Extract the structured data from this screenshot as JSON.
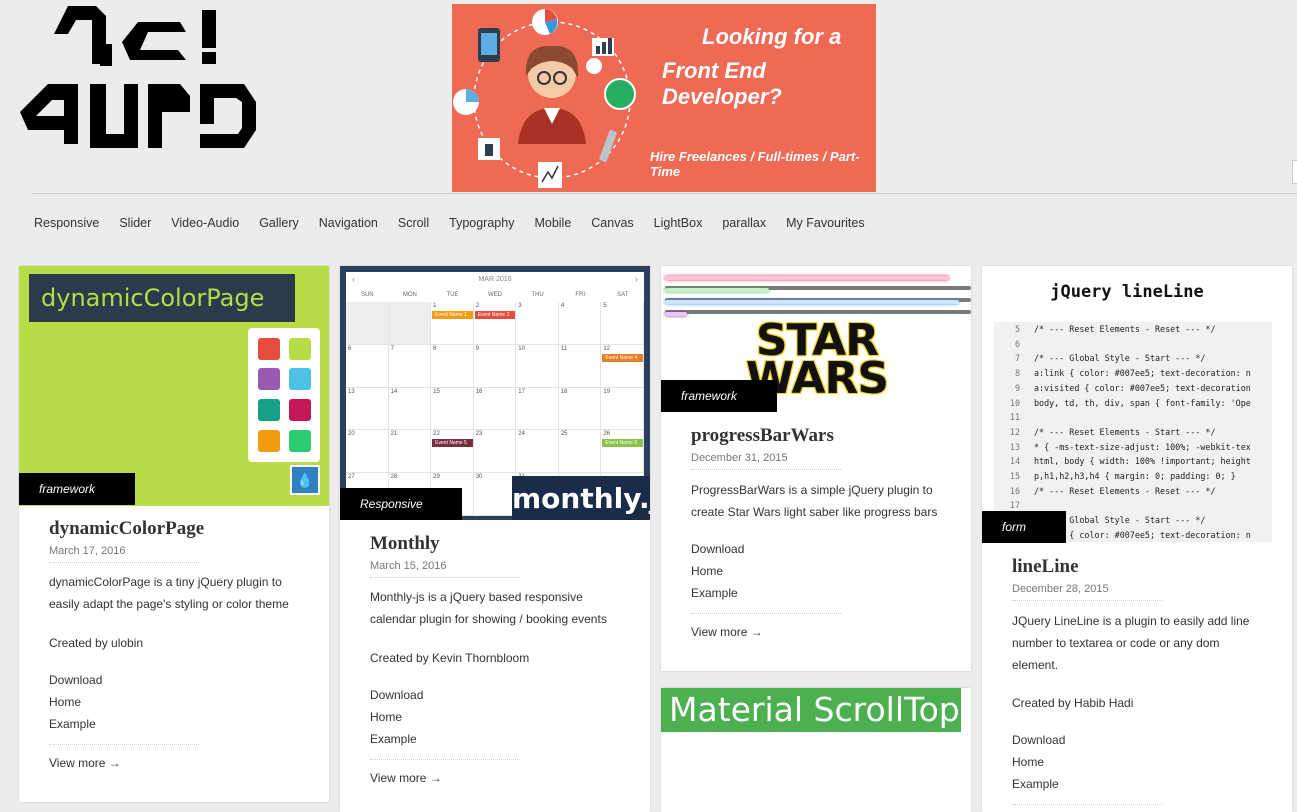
{
  "banner": {
    "line1": "Looking for a",
    "line2": "Front End Developer?",
    "line3": "Hire Freelances / Full-times / Part-Time"
  },
  "nav": [
    "Responsive",
    "Slider",
    "Video-Audio",
    "Gallery",
    "Navigation",
    "Scroll",
    "Typography",
    "Mobile",
    "Canvas",
    "LightBox",
    "parallax",
    "My Favourites"
  ],
  "cards": [
    {
      "tag": "framework",
      "thumb_title": "dynamicColorPage",
      "title": "dynamicColorPage",
      "date": "March 17, 2016",
      "desc_lines": [
        "dynamicColorPage is a tiny jQuery plugin to",
        "easily adapt the page's styling or color theme"
      ],
      "author": "Created by ulobin",
      "links": [
        "Download",
        "Home",
        "Example"
      ],
      "more": "View more →"
    },
    {
      "tag": "Responsive",
      "thumb_title": "monthly.js",
      "title": "Monthly",
      "date": "March 15, 2016",
      "desc_lines": [
        "Monthly-js is a jQuery based responsive",
        "calendar plugin for showing / booking events"
      ],
      "author": "Created by Kevin Thornbloom",
      "links": [
        "Download",
        "Home",
        "Example"
      ],
      "more": "View more →"
    },
    {
      "tag": "framework",
      "thumb_title": "STAR WARS",
      "title": "progressBarWars",
      "date": "December 31, 2015",
      "desc_lines": [
        "ProgressBarWars is a simple jQuery plugin to",
        "create Star Wars light saber like progress bars"
      ],
      "links": [
        "Download",
        "Home",
        "Example"
      ],
      "more": "View more →"
    },
    {
      "tag": "form",
      "thumb_title": "jQuery lineLine",
      "title": "lineLine",
      "date": "December 28, 2015",
      "desc_lines": [
        "JQuery LineLine is a plugin to easily add line",
        "number to textarea or code or any dom",
        "element."
      ],
      "author": "Created by Habib Hadi",
      "links": [
        "Download",
        "Home",
        "Example"
      ]
    }
  ],
  "calendar": {
    "month": "MAR 2016",
    "days": [
      "SUN",
      "MON",
      "TUE",
      "WED",
      "THU",
      "FRI",
      "SAT"
    ],
    "events": [
      "Event Name 1",
      "Event Name 2",
      "Event Name 4",
      "Event Name 5",
      "Event Name 6"
    ]
  },
  "code_lines": [
    [
      "5",
      "/* --- Reset Elements - Reset --- */"
    ],
    [
      "6",
      ""
    ],
    [
      "7",
      "/* --- Global Style - Start --- */"
    ],
    [
      "8",
      "a:link { color: #007ee5; text-decoration: n"
    ],
    [
      "9",
      "a:visited { color: #007ee5; text-decoration"
    ],
    [
      "10",
      "body, td, th, div, span { font-family: 'Ope"
    ],
    [
      "11",
      ""
    ],
    [
      "12",
      "/* --- Reset Elements - Start --- */"
    ],
    [
      "13",
      "* { -ms-text-size-adjust: 100%; -webkit-tex"
    ],
    [
      "14",
      "html, body { width: 100% !important; height"
    ],
    [
      "15",
      "p,h1,h2,h3,h4 { margin: 0; padding: 0; }"
    ],
    [
      "16",
      "/* --- Reset Elements - Reset --- */"
    ],
    [
      "17",
      ""
    ],
    [
      "18",
      "/* --- Global Style - Start --- */"
    ],
    [
      "19",
      "a:link { color: #007ee5; text-decoration: n"
    ]
  ],
  "material": "Material ScrollTop",
  "colors": {
    "banner": "#ef6a55",
    "lime": "#b6dd45",
    "swatches": [
      "#e74c3c",
      "#b6dd45",
      "#9b59b6",
      "#4fc0e8",
      "#16a085",
      "#c2185b",
      "#f39c12",
      "#2ecc71"
    ]
  }
}
